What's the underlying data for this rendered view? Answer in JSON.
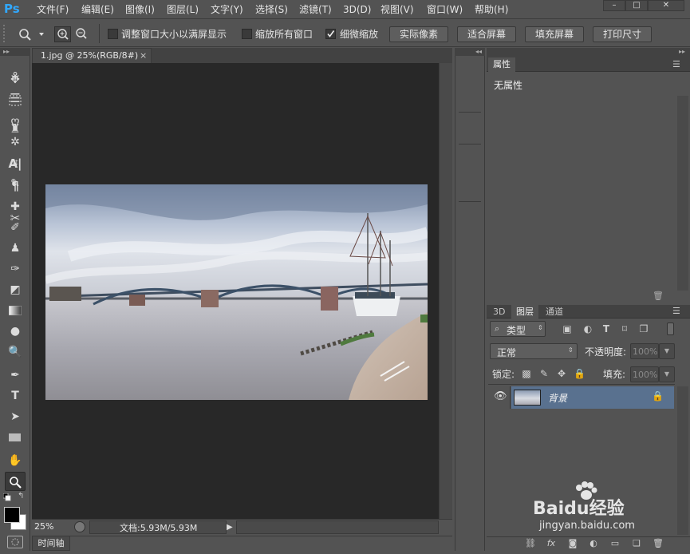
{
  "app": {
    "logo": "Ps"
  },
  "menu": [
    "文件(F)",
    "编辑(E)",
    "图像(I)",
    "图层(L)",
    "文字(Y)",
    "选择(S)",
    "滤镜(T)",
    "3D(D)",
    "视图(V)",
    "窗口(W)",
    "帮助(H)"
  ],
  "window_controls": {
    "minimize": "–",
    "maximize": "□",
    "close": "✕"
  },
  "options": {
    "resize_windows_label": "调整窗口大小以满屏显示",
    "zoom_all_label": "缩放所有窗口",
    "scrubby_zoom_label": "细微缩放",
    "scrubby_checked": true,
    "btn_actual": "实际像素",
    "btn_fit": "适合屏幕",
    "btn_fill": "填充屏幕",
    "btn_print": "打印尺寸"
  },
  "document": {
    "tab": "1.jpg @ 25%(RGB/8#)",
    "close": "×"
  },
  "status": {
    "zoom": "25%",
    "doc_info": "文档:5.93M/5.93M"
  },
  "timeline_label": "时间轴",
  "properties": {
    "tab": "属性",
    "content": "无属性"
  },
  "layers": {
    "tabs": [
      "3D",
      "图层",
      "通道"
    ],
    "filter_kind": "类型",
    "blend_mode": "正常",
    "opacity_label": "不透明度:",
    "opacity_value": "100%",
    "lock_label": "锁定:",
    "fill_label": "填充:",
    "fill_value": "100%",
    "layer_name": "背景"
  },
  "watermark": {
    "brand": "Baidu经验",
    "url": "jingyan.baidu.com"
  },
  "colors": {
    "bg": "#535353",
    "canvas": "#282828",
    "selected_layer": "#59718f",
    "logo": "#31a8ff"
  }
}
